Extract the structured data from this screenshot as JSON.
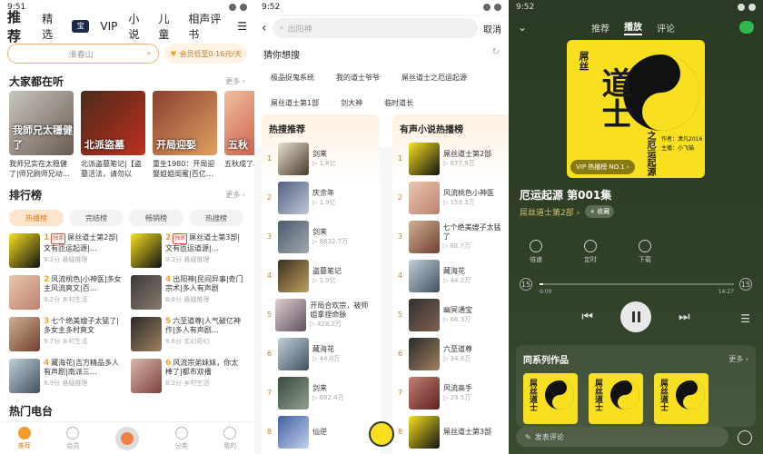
{
  "p1": {
    "time": "9:51",
    "nav": [
      "推荐",
      "精选",
      "VIP",
      "小说",
      "儿童",
      "相声评书"
    ],
    "nav_logo": "宝",
    "menu": "☰",
    "search_placeholder": "淮春山",
    "vip_text": "会员低至0.16元/天",
    "sec1": "大家都在听",
    "more": "更多 ›",
    "books": [
      {
        "title": "我师兄实在太稳健了|师兄刷师兄动…",
        "cover": "我師兄太穩健了",
        "c1": "#c8c6c0",
        "c2": "#6a5a50"
      },
      {
        "title": "北派盗墓笔记|【盗墓活法，请勿以身…",
        "cover": "北派盜墓",
        "c1": "#4a2a1a",
        "c2": "#c03020"
      },
      {
        "title": "重生1980：开局迎娶姐姐闺蜜|百亿…",
        "cover": "开局迎娶",
        "c1": "#8a4030",
        "c2": "#e0a060"
      },
      {
        "title": "五秋成了小说…",
        "cover": "五秋",
        "c1": "#f0c0a0",
        "c2": "#c04030"
      }
    ],
    "sec2": "排行榜",
    "ranktabs": [
      "热播榜",
      "完结榜",
      "畅销榜",
      "热搜榜"
    ],
    "ranks": [
      {
        "n": "1",
        "badge": "独家",
        "title": "屌丝道士第2部|文有匝运起源|…",
        "sub": "9.2分  悬疑推理",
        "c1": "#f8e020",
        "c2": "#111"
      },
      {
        "n": "2",
        "badge": "独家",
        "title": "屌丝道士第3部|文有匝运道源|…",
        "sub": "9.2分  悬疑推理",
        "c1": "#f8e020",
        "c2": "#111"
      },
      {
        "n": "2",
        "badge": "",
        "title": "风流桃色|小神医|多女主风流爽文|百…",
        "sub": "9.2分  乡村生活",
        "c1": "#e8c8b0",
        "c2": "#c08070"
      },
      {
        "n": "4",
        "badge": "",
        "title": "出阳神|民间异事|奇门宗术|多人有声剧",
        "sub": "8.9分  悬疑推理",
        "c1": "#3a3a3a",
        "c2": "#8a7a6a"
      },
      {
        "n": "3",
        "badge": "",
        "title": "七个绝美嫂子太猛了|多女主多村爽文",
        "sub": "9.7分  乡村生活",
        "c1": "#d0b090",
        "c2": "#704030"
      },
      {
        "n": "5",
        "badge": "",
        "title": "六至道尊|人气破亿神作|多人有声剧…",
        "sub": "9.6分  玄幻奇幻",
        "c1": "#2a2a2a",
        "c2": "#a08060"
      },
      {
        "n": "4",
        "badge": "",
        "title": "藏海花|吉方精品多人有声剧|南派三…",
        "sub": "8.9分  悬疑推理",
        "c1": "#c0d0d8",
        "c2": "#405060"
      },
      {
        "n": "6",
        "badge": "",
        "title": "风流宗弟妹妹，你太棒了|都市双播",
        "sub": "8.2分  乡村生活",
        "c1": "#d8b8a8",
        "c2": "#804040"
      }
    ],
    "sec3": "热门电台",
    "bottom": [
      "推荐",
      "会员",
      "分类",
      "我的"
    ]
  },
  "p2": {
    "time": "9:52",
    "placeholder": "出阳神",
    "cancel": "取消",
    "guess": "猜你想搜",
    "chips": [
      "极品捉鬼系统",
      "我的道士爷爷",
      "屌丝道士之厄运起源",
      "屌丝道士第1部",
      "剑大神",
      "临时道长",
      "小道士下山捉鬼记"
    ],
    "hot_title": "热搜推荐",
    "hot": [
      {
        "n": "1",
        "title": "剑来",
        "sub": "▷ 1.8亿",
        "c1": "#e8e0d0",
        "c2": "#4a3a2a"
      },
      {
        "n": "2",
        "title": "庆余年",
        "sub": "▷ 1.9亿",
        "c1": "#506080",
        "c2": "#c0c8d8"
      },
      {
        "n": "3",
        "title": "剑来",
        "sub": "▷ 8832.7万",
        "c1": "#4a5a6a",
        "c2": "#a0a8b0"
      },
      {
        "n": "4",
        "title": "盗墓笔记",
        "sub": "▷ 1.9亿",
        "c1": "#3a3020",
        "c2": "#c0a060"
      },
      {
        "n": "5",
        "title": "开局合欢宗，被师姐拿捏命脉",
        "sub": "▷ 428.2万",
        "c1": "#e0d0d0",
        "c2": "#605060"
      },
      {
        "n": "6",
        "title": "藏海花",
        "sub": "▷ 44.0万",
        "c1": "#c0d0d8",
        "c2": "#405060"
      },
      {
        "n": "7",
        "title": "剑来",
        "sub": "▷ 682.4万",
        "c1": "#3a4a3a",
        "c2": "#90a090"
      },
      {
        "n": "8",
        "title": "仙逆",
        "sub": "",
        "c1": "#4060a0",
        "c2": "#c0d0f0"
      }
    ],
    "aud_title": "有声小说热播榜",
    "aud": [
      {
        "n": "1",
        "title": "屌丝道士第2部",
        "sub": "▷ 677.9万",
        "c1": "#f8e020",
        "c2": "#111"
      },
      {
        "n": "2",
        "title": "风流桃色小神医",
        "sub": "▷ 159.3万",
        "c1": "#e8c8b0",
        "c2": "#c08070"
      },
      {
        "n": "3",
        "title": "七个绝美嫂子太猛了",
        "sub": "▷ 88.7万",
        "c1": "#d0b090",
        "c2": "#704030"
      },
      {
        "n": "4",
        "title": "藏海花",
        "sub": "▷ 44.2万",
        "c1": "#c0d0d8",
        "c2": "#405060"
      },
      {
        "n": "5",
        "title": "幽冥通宝",
        "sub": "▷ 66.3万",
        "c1": "#303030",
        "c2": "#806050"
      },
      {
        "n": "6",
        "title": "六至道尊",
        "sub": "▷ 34.9万",
        "c1": "#2a2a2a",
        "c2": "#a08060"
      },
      {
        "n": "7",
        "title": "风流高手",
        "sub": "▷ 29.5万",
        "c1": "#c08070",
        "c2": "#602020"
      },
      {
        "n": "8",
        "title": "屌丝道士第3部",
        "sub": "",
        "c1": "#f8e020",
        "c2": "#111"
      }
    ]
  },
  "p3": {
    "time": "9:52",
    "tabs": [
      "推荐",
      "播放",
      "评论"
    ],
    "cover_small": "屌丝",
    "cover_big": "道士",
    "cover_sub": "之厄运起源",
    "cover_author": "作者：潇凡2016",
    "cover_reader": "主播：小飞猫",
    "viptag": "VIP 热播榜 NO.1 ›",
    "episode": "厄运起源 第001集",
    "series": "屌丝道士第2部 ›",
    "collect": "+ 收藏",
    "ctrls": [
      "倍速",
      "定时",
      "下载"
    ],
    "time_start": "0:00",
    "time_end": "14:27",
    "skip": "15",
    "series_title": "同系列作品",
    "more": "更多 ›",
    "series_covers": [
      "屌丝道士",
      "屌丝道士",
      "屌丝道士"
    ],
    "comment": "发表评论"
  }
}
